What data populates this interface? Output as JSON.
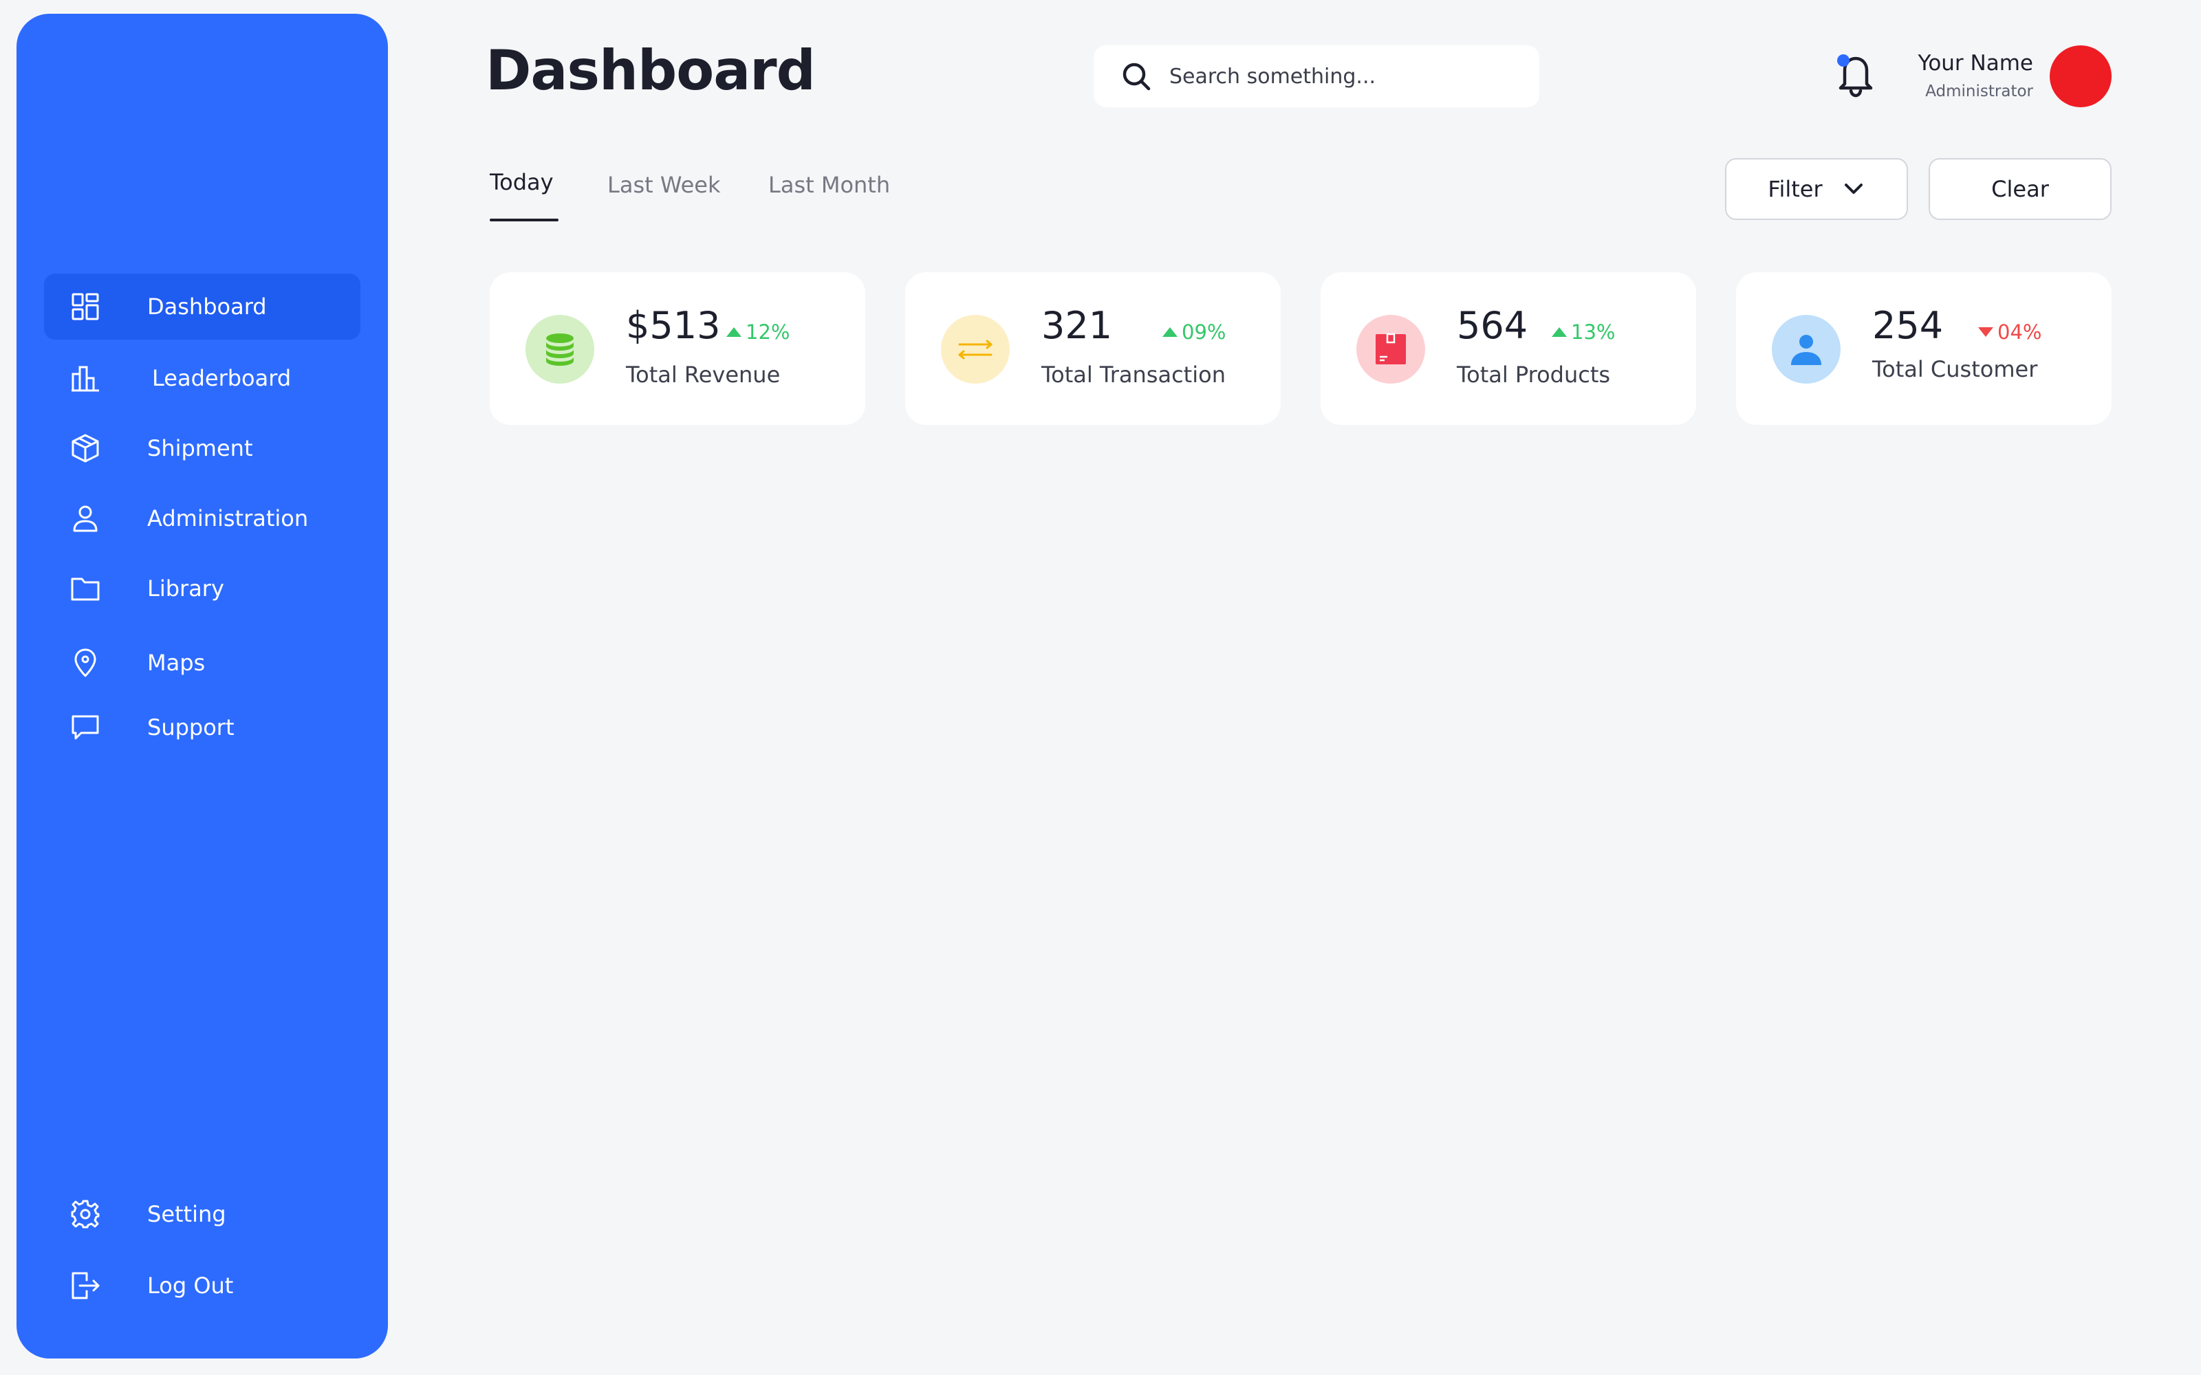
{
  "colors": {
    "sidebar": "#2d6bff",
    "sidebar_active": "#1f5cf0",
    "background": "#f5f6f8",
    "positive": "#35c76a",
    "negative": "#f04848",
    "avatar": "#ee1d23",
    "notification_dot": "#2d6bff"
  },
  "sidebar": {
    "items": [
      {
        "label": "Dashboard",
        "icon": "dashboard-grid-icon",
        "active": true
      },
      {
        "label": "Leaderboard",
        "icon": "bar-chart-icon"
      },
      {
        "label": "Shipment",
        "icon": "box-icon"
      },
      {
        "label": "Administration",
        "icon": "user-icon"
      },
      {
        "label": "Library",
        "icon": "folder-icon"
      },
      {
        "label": "Maps",
        "icon": "map-pin-icon"
      },
      {
        "label": "Support",
        "icon": "chat-bubble-icon"
      }
    ],
    "bottom": [
      {
        "label": "Setting",
        "icon": "gear-icon"
      },
      {
        "label": "Log Out",
        "icon": "logout-icon"
      }
    ]
  },
  "header": {
    "title": "Dashboard",
    "search_placeholder": "Search something...",
    "user_name": "Your Name",
    "user_role": "Administrator"
  },
  "tabs": [
    {
      "label": "Today",
      "active": true
    },
    {
      "label": "Last Week"
    },
    {
      "label": "Last Month"
    }
  ],
  "actions": {
    "filter_label": "Filter",
    "clear_label": "Clear"
  },
  "stats": [
    {
      "value": "$513",
      "change": "12%",
      "direction": "up",
      "label": "Total Revenue",
      "icon": "coin-stack-icon",
      "icon_bg": "#d4f0c4",
      "icon_color": "#5cc42b"
    },
    {
      "value": "321",
      "change": "09%",
      "direction": "up",
      "label": "Total Transaction",
      "icon": "exchange-arrows-icon",
      "icon_bg": "#fdefc4",
      "icon_color": "#f5b400"
    },
    {
      "value": "564",
      "change": "13%",
      "direction": "up",
      "label": "Total Products",
      "icon": "product-box-icon",
      "icon_bg": "#fccfd3",
      "icon_color": "#f0394f"
    },
    {
      "value": "254",
      "change": "04%",
      "direction": "down",
      "label": "Total Customer",
      "icon": "customer-icon",
      "icon_bg": "#bfdffb",
      "icon_color": "#2d8cf0"
    }
  ]
}
